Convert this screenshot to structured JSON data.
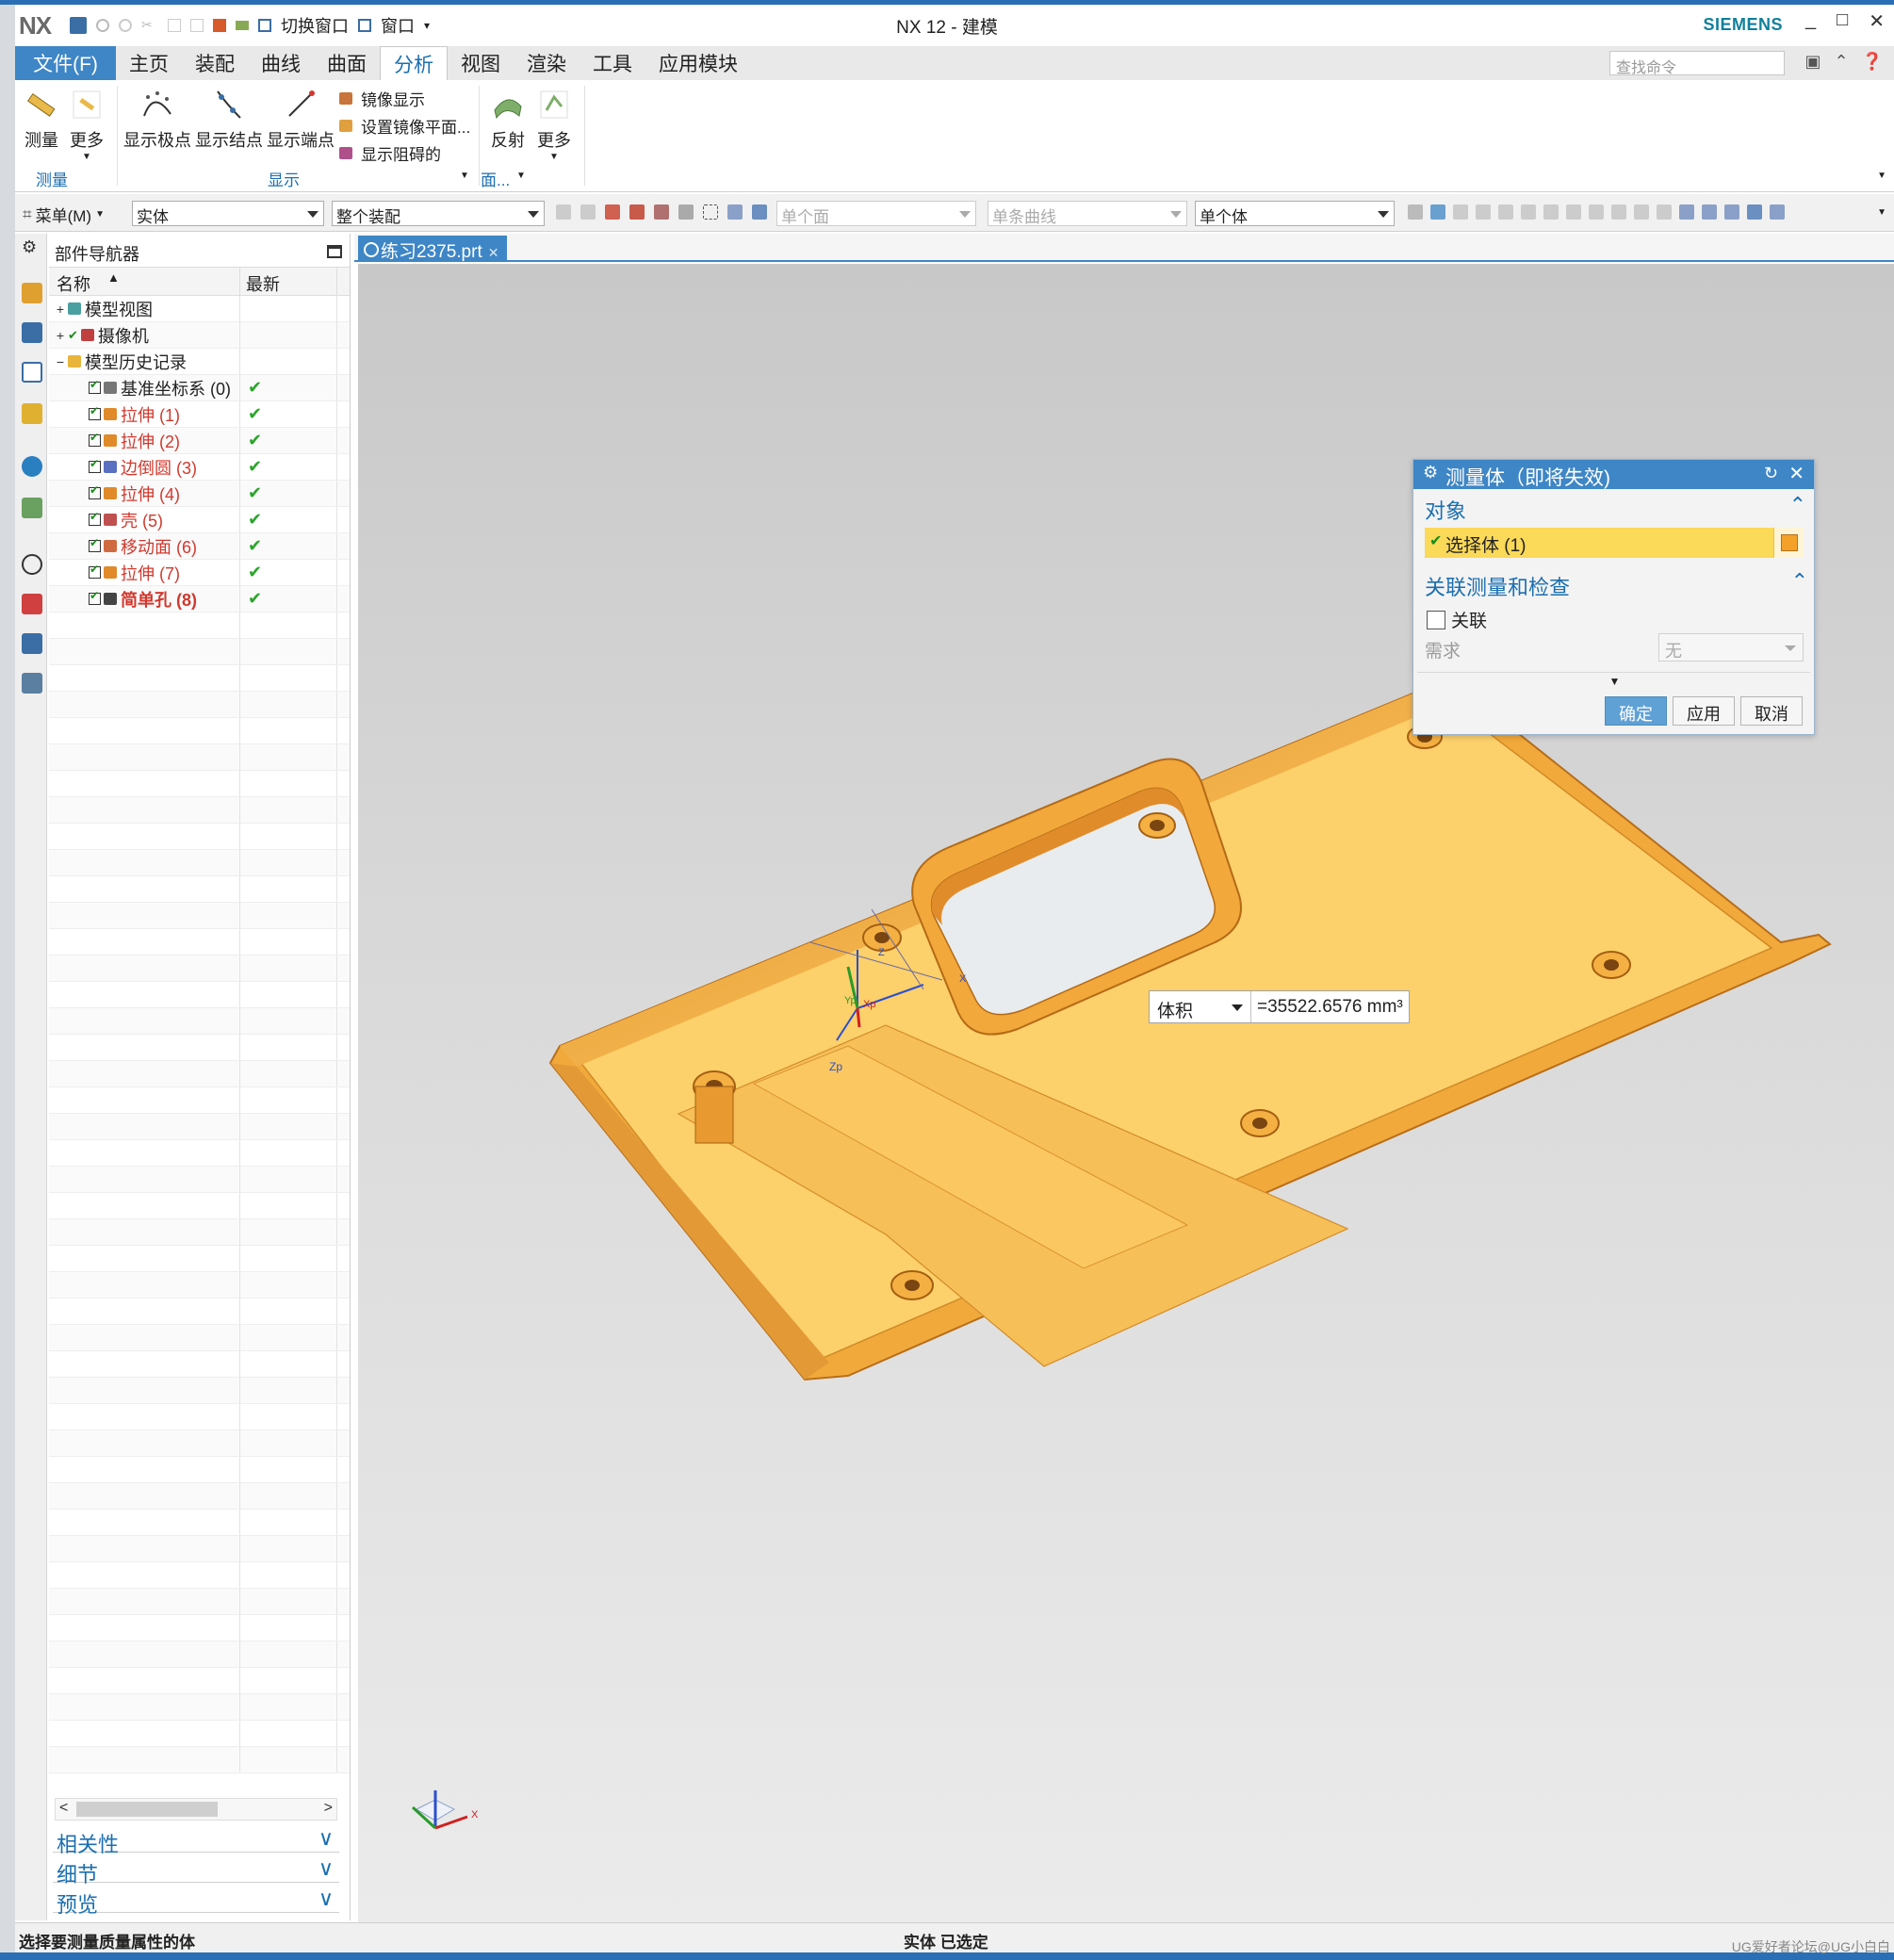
{
  "app": {
    "logo": "NX",
    "window_title": "NX 12 - 建模",
    "brand": "SIEMENS",
    "quick_access": {
      "switch_window": "切换窗口",
      "window": "窗口"
    },
    "window_controls": {
      "minimize": "_",
      "maximize": "□",
      "close": "✕"
    }
  },
  "ribbon_tabs": {
    "file": "文件(F)",
    "items": [
      "主页",
      "装配",
      "曲线",
      "曲面",
      "分析",
      "视图",
      "渲染",
      "工具",
      "应用模块"
    ],
    "active": "分析",
    "search_placeholder": "查找命令"
  },
  "ribbon": {
    "measure": "测量",
    "more1": "更多",
    "show_poles": "显示极点",
    "show_knots": "显示结点",
    "show_endpoints": "显示端点",
    "mirror_display": "镜像显示",
    "set_mirror_plane": "设置镜像平面...",
    "show_blocking": "显示阻碍的",
    "reflection": "反射",
    "more2": "更多",
    "group_measure": "测量",
    "group_display": "显示",
    "group_face": "面..."
  },
  "selection_bar": {
    "menu": "菜单(M)",
    "type_filter": "实体",
    "scope": "整个装配",
    "face_rule": "单个面",
    "curve_rule": "单条曲线",
    "body_rule": "单个体"
  },
  "part_navigator": {
    "title": "部件导航器",
    "col_name": "名称",
    "col_latest": "最新",
    "rows": [
      {
        "toggle": "+",
        "label": "模型视图",
        "style": "normal",
        "latest": "",
        "icon": "model-views"
      },
      {
        "toggle": "+",
        "label": "摄像机",
        "style": "normal",
        "latest": "",
        "icon": "cameras"
      },
      {
        "toggle": "−",
        "label": "模型历史记录",
        "style": "normal",
        "latest": "",
        "icon": "folder"
      },
      {
        "toggle": "",
        "label": "基准坐标系 (0)",
        "style": "normal",
        "latest": "✔",
        "icon": "datum-csys"
      },
      {
        "toggle": "",
        "label": "拉伸 (1)",
        "style": "red",
        "latest": "✔",
        "icon": "extrude"
      },
      {
        "toggle": "",
        "label": "拉伸 (2)",
        "style": "red",
        "latest": "✔",
        "icon": "extrude"
      },
      {
        "toggle": "",
        "label": "边倒圆 (3)",
        "style": "red",
        "latest": "✔",
        "icon": "edge-blend"
      },
      {
        "toggle": "",
        "label": "拉伸 (4)",
        "style": "red",
        "latest": "✔",
        "icon": "extrude"
      },
      {
        "toggle": "",
        "label": "壳 (5)",
        "style": "red",
        "latest": "✔",
        "icon": "shell"
      },
      {
        "toggle": "",
        "label": "移动面 (6)",
        "style": "red",
        "latest": "✔",
        "icon": "move-face"
      },
      {
        "toggle": "",
        "label": "拉伸 (7)",
        "style": "red",
        "latest": "✔",
        "icon": "extrude"
      },
      {
        "toggle": "",
        "label": "简单孔 (8)",
        "style": "redbold",
        "latest": "✔",
        "icon": "hole"
      }
    ],
    "sections": [
      "相关性",
      "细节",
      "预览"
    ]
  },
  "document_tab": {
    "label": "练习2375.prt"
  },
  "measurement_tag": {
    "quantity": "体积",
    "value": "=35522.6576 mm³"
  },
  "axes_labels": {
    "x": "X",
    "y": "Y",
    "z": "Z",
    "xp": "Xp",
    "yp": "Yp",
    "zp": "Zp"
  },
  "dialog": {
    "title": "测量体（即将失效)",
    "section_object": "对象",
    "select_body": "选择体 (1)",
    "section_assoc": "关联测量和检查",
    "assoc_label": "关联",
    "requirement_label": "需求",
    "requirement_value": "无",
    "ok": "确定",
    "apply": "应用",
    "cancel": "取消"
  },
  "status": {
    "prompt": "选择要测量质量属性的体",
    "selection": "实体 已选定"
  },
  "watermark": "UG爱好者论坛@UG小白白",
  "colors": {
    "accent": "#3e86c6",
    "part_body": "#f7bd54",
    "feature_red": "#d0392e",
    "dialog_highlight": "#fbd959"
  }
}
